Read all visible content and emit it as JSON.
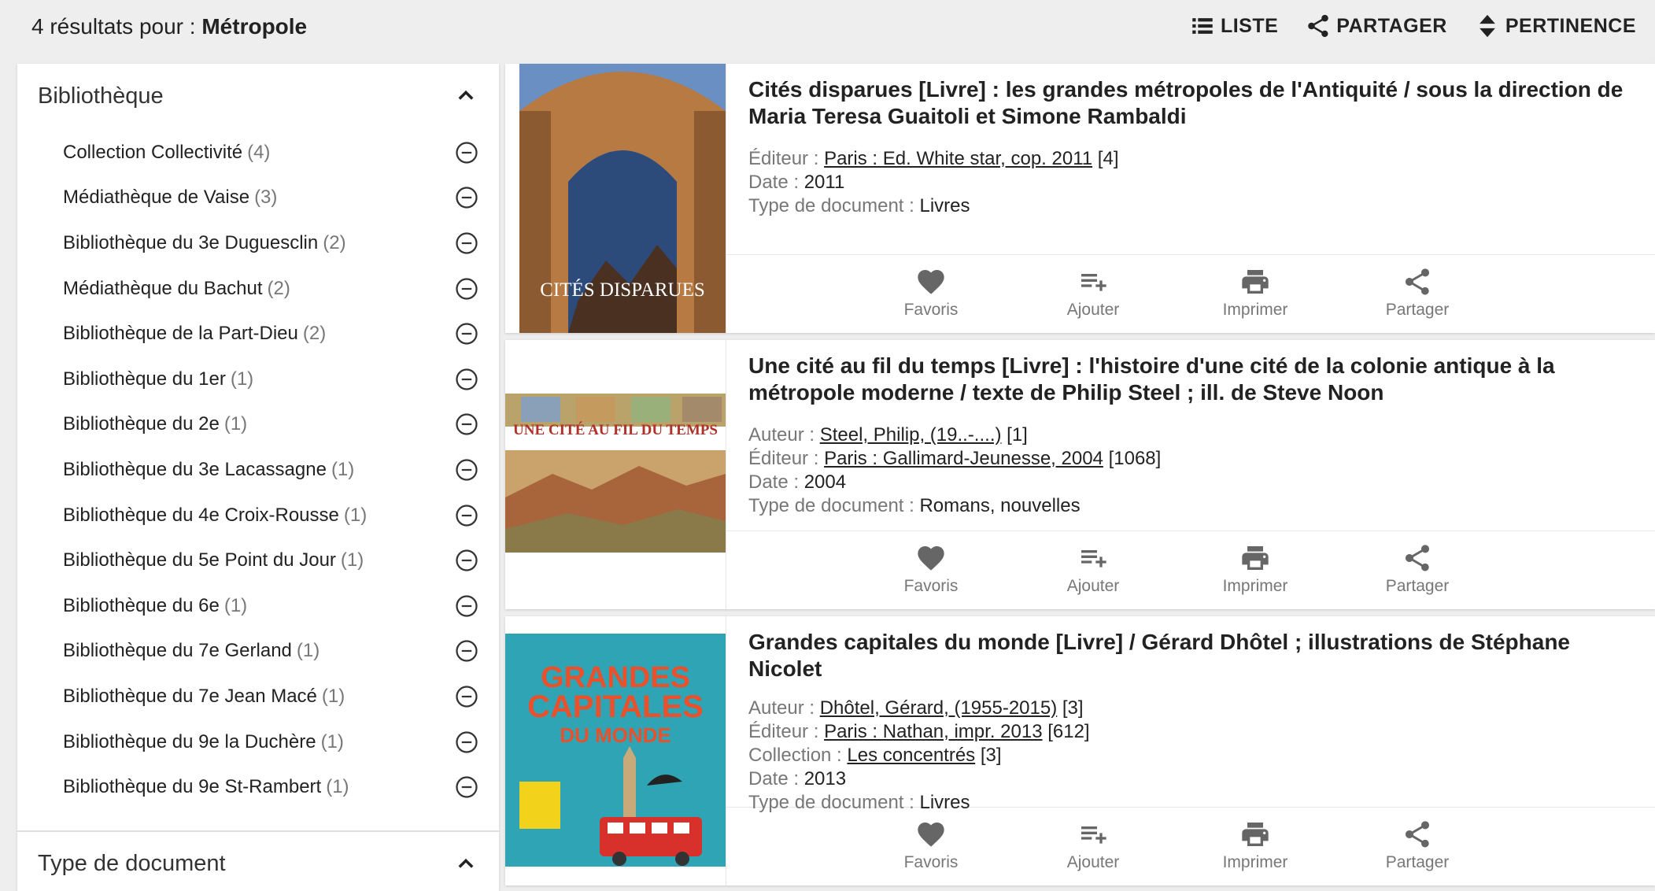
{
  "header": {
    "results_prefix": "4 résultats pour :",
    "query": "Métropole",
    "list_label": "LISTE",
    "share_label": "PARTAGER",
    "sort_label": "PERTINENCE"
  },
  "sidebar": {
    "facet1_title": "Bibliothèque",
    "items": [
      {
        "label": "Collection Collectivité",
        "count": "(4)"
      },
      {
        "label": "Médiathèque de Vaise",
        "count": "(3)"
      },
      {
        "label": "Bibliothèque du 3e Duguesclin",
        "count": "(2)"
      },
      {
        "label": "Médiathèque du Bachut",
        "count": "(2)"
      },
      {
        "label": "Bibliothèque de la Part-Dieu",
        "count": "(2)"
      },
      {
        "label": "Bibliothèque du 1er",
        "count": "(1)"
      },
      {
        "label": "Bibliothèque du 2e",
        "count": "(1)"
      },
      {
        "label": "Bibliothèque du 3e Lacassagne",
        "count": "(1)"
      },
      {
        "label": "Bibliothèque du 4e Croix-Rousse",
        "count": "(1)"
      },
      {
        "label": "Bibliothèque du 5e Point du Jour",
        "count": "(1)"
      },
      {
        "label": "Bibliothèque du 6e",
        "count": "(1)"
      },
      {
        "label": "Bibliothèque du 7e Gerland",
        "count": "(1)"
      },
      {
        "label": "Bibliothèque du 7e Jean Macé",
        "count": "(1)"
      },
      {
        "label": "Bibliothèque du 9e la Duchère",
        "count": "(1)"
      },
      {
        "label": "Bibliothèque du 9e St-Rambert",
        "count": "(1)"
      }
    ],
    "facet2_title": "Type de document"
  },
  "actions": {
    "favoris": "Favoris",
    "ajouter": "Ajouter",
    "imprimer": "Imprimer",
    "partager": "Partager"
  },
  "results": [
    {
      "title": "Cités disparues [Livre] : les grandes métropoles de l'Antiquité / sous la direction de Maria Teresa Guaitoli et Simone Rambaldi",
      "cover_text": "CITÉS DISPARUES",
      "editeur_key": "Éditeur :",
      "editeur_link": "Paris : Ed. White star, cop. 2011",
      "editeur_count": "[4]",
      "date_key": "Date :",
      "date_val": "2011",
      "type_key": "Type de document :",
      "type_val": "Livres"
    },
    {
      "title": "Une cité au fil du temps [Livre] : l'histoire d'une cité de la colonie antique à la métropole moderne / texte de Philip Steel ; ill. de Steve Noon",
      "cover_text": "UNE CITÉ AU FIL DU TEMPS",
      "auteur_key": "Auteur :",
      "auteur_link": "Steel, Philip, (19..-....)",
      "auteur_count": "[1]",
      "editeur_key": "Éditeur :",
      "editeur_link": "Paris : Gallimard-Jeunesse, 2004",
      "editeur_count": "[1068]",
      "date_key": "Date :",
      "date_val": "2004",
      "type_key": "Type de document :",
      "type_val": "Romans, nouvelles"
    },
    {
      "title": "Grandes capitales du monde [Livre] / Gérard Dhôtel ; illustrations de Stéphane Nicolet",
      "cover_line1": "GRANDES",
      "cover_line2": "CAPITALES",
      "cover_line3": "DU MONDE",
      "auteur_key": "Auteur :",
      "auteur_link": "Dhôtel, Gérard, (1955-2015)",
      "auteur_count": "[3]",
      "editeur_key": "Éditeur :",
      "editeur_link": "Paris : Nathan, impr. 2013",
      "editeur_count": "[612]",
      "collection_key": "Collection :",
      "collection_link": "Les concentrés",
      "collection_count": "[3]",
      "date_key": "Date :",
      "date_val": "2013",
      "type_key": "Type de document :",
      "type_val": "Livres"
    }
  ]
}
